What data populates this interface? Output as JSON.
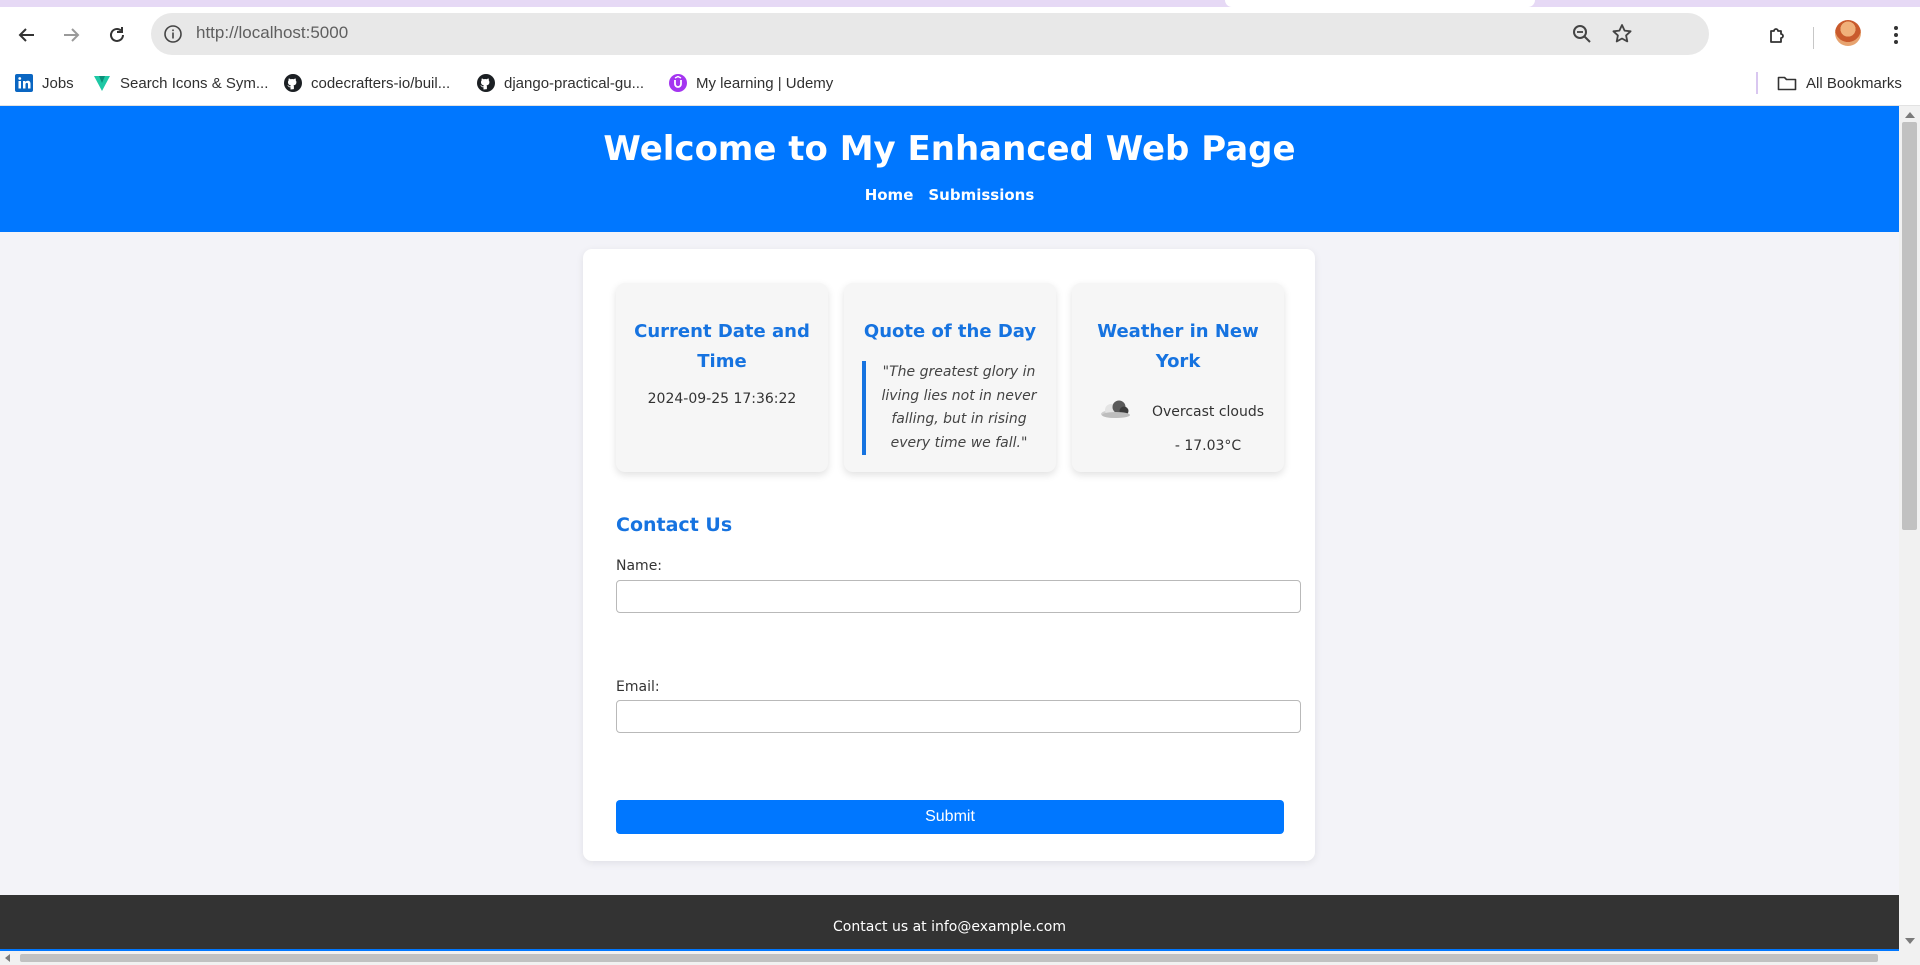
{
  "browser": {
    "url": "http://localhost:5000",
    "bookmarks": [
      {
        "label": "Jobs",
        "icon": "linkedin-icon"
      },
      {
        "label": "Search Icons & Sym...",
        "icon": "vuetify-icon"
      },
      {
        "label": "codecrafters-io/buil...",
        "icon": "github-icon"
      },
      {
        "label": "django-practical-gu...",
        "icon": "github-icon"
      },
      {
        "label": "My learning | Udemy",
        "icon": "udemy-icon"
      }
    ],
    "all_bookmarks_label": "All Bookmarks"
  },
  "header": {
    "title": "Welcome to My Enhanced Web Page",
    "nav": [
      "Home",
      "Submissions"
    ]
  },
  "cards": {
    "datetime": {
      "title": "Current Date and Time",
      "value": "2024-09-25 17:36:22"
    },
    "quote": {
      "title": "Quote of the Day",
      "text": "\"The greatest glory in living lies not in never falling, but in rising every time we fall.\""
    },
    "weather": {
      "title": "Weather in New York",
      "description": "Overcast clouds - 17.03°C",
      "icon": "cloud-icon"
    }
  },
  "contact": {
    "title": "Contact Us",
    "name_label": "Name:",
    "name_value": "",
    "email_label": "Email:",
    "email_value": "",
    "submit_label": "Submit"
  },
  "footer": {
    "text": "Contact us at info@example.com"
  },
  "colors": {
    "primary": "#0077ff",
    "heading": "#1673e0",
    "footer_bg": "#333333",
    "page_bg": "#f3f3f8"
  }
}
